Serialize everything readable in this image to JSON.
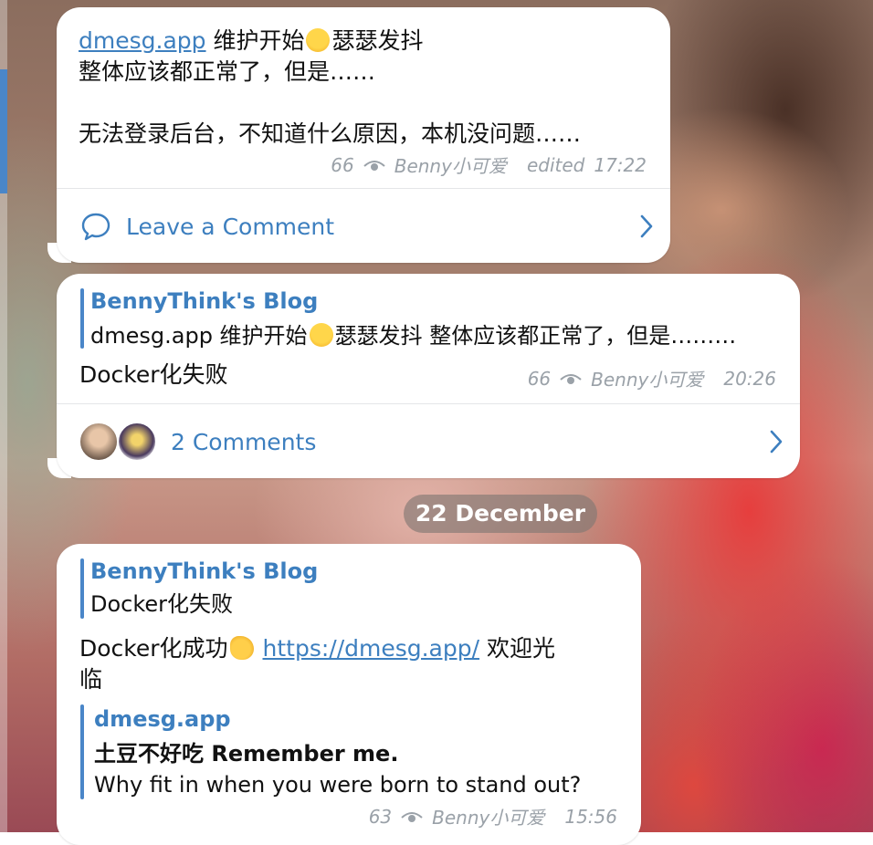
{
  "messages": [
    {
      "link_text": "dmesg.app",
      "line1_a": "维护开始",
      "line1_b": "瑟瑟发抖",
      "line2": "整体应该都正常了，但是……",
      "line3": "无法登录后台，不知道什么原因，本机没问题……",
      "views": "66",
      "author": "Benny小可爱",
      "edited": "edited",
      "time": "17:22",
      "comment_label": "Leave a Comment"
    },
    {
      "reply_title": "BennyThink's Blog",
      "reply_text_a": "dmesg.app 维护开始",
      "reply_text_b": "瑟瑟发抖 整体应该都正常了，但是………",
      "body": "Docker化失败",
      "views": "66",
      "author": "Benny小可爱",
      "time": "20:26",
      "comment_label": "2 Comments"
    },
    {
      "reply_title": "BennyThink's Blog",
      "reply_text": "Docker化失败",
      "body_a": "Docker化成功",
      "body_link": "https://dmesg.app/",
      "body_b": " 欢迎光",
      "body_c": "临",
      "preview_site": "dmesg.app",
      "preview_title": "土豆不好吃 Remember me.",
      "preview_desc": "Why fit in when you were born to stand out?",
      "views": "63",
      "author": "Benny小可爱",
      "time": "15:56"
    }
  ],
  "date_separator": "22 December",
  "colors": {
    "accent": "#3d7fbf",
    "bubble": "#ffffff",
    "meta": "#9aa1a8"
  },
  "icons": [
    "eye-icon",
    "comment-icon",
    "chevron-right-icon",
    "laughing-emoji",
    "clapping-emoji",
    "avatar"
  ]
}
